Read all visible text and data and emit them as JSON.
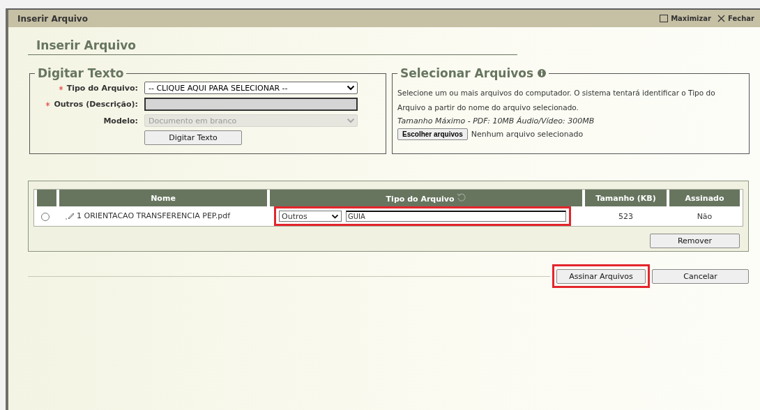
{
  "window": {
    "title": "Inserir Arquivo",
    "actions": [
      {
        "kind": "maximize",
        "label": "Maximizar"
      },
      {
        "kind": "close",
        "label": "Fechar"
      }
    ]
  },
  "heading": "Inserir Arquivo",
  "digitar_texto": {
    "legend": "Digitar Texto",
    "fields": [
      {
        "kind": "select",
        "label": "Tipo do Arquivo:",
        "required": true,
        "disabled": false,
        "value": "-- CLIQUE AQUI PARA SELECIONAR --"
      },
      {
        "kind": "text",
        "label": "Outros (Descrição):",
        "required": true,
        "disabled": true
      },
      {
        "kind": "select",
        "label": "Modelo:",
        "required": false,
        "disabled": true,
        "value": "Documento em branco"
      }
    ],
    "button": "Digitar Texto"
  },
  "selecionar_arquivos": {
    "legend": "Selecionar Arquivos",
    "description": "Selecione um ou mais arquivos do computador. O sistema tentará identificar o Tipo do Arquivo a partir do nome do arquivo selecionado.",
    "limits": "Tamanho Máximo - PDF: 10MB  Áudio/Vídeo: 300MB",
    "choose_button": "Escolher arquivos",
    "file_status": "Nenhum arquivo selecionado"
  },
  "table": {
    "columns": [
      "Nome",
      "Tipo do Arquivo",
      "Tamanho (KB)",
      "Assinado"
    ],
    "rows": [
      {
        "selected": false,
        "name": "1 ORIENTACAO TRANSFERENCIA PEP.pdf",
        "type": "Outros",
        "description": "GUIA",
        "highlighted": true,
        "size": "523",
        "signed": "Não"
      }
    ],
    "remove_button": "Remover"
  },
  "buttons": [
    {
      "label": "Assinar Arquivos",
      "highlighted": true
    },
    {
      "label": "Cancelar",
      "highlighted": false
    }
  ]
}
